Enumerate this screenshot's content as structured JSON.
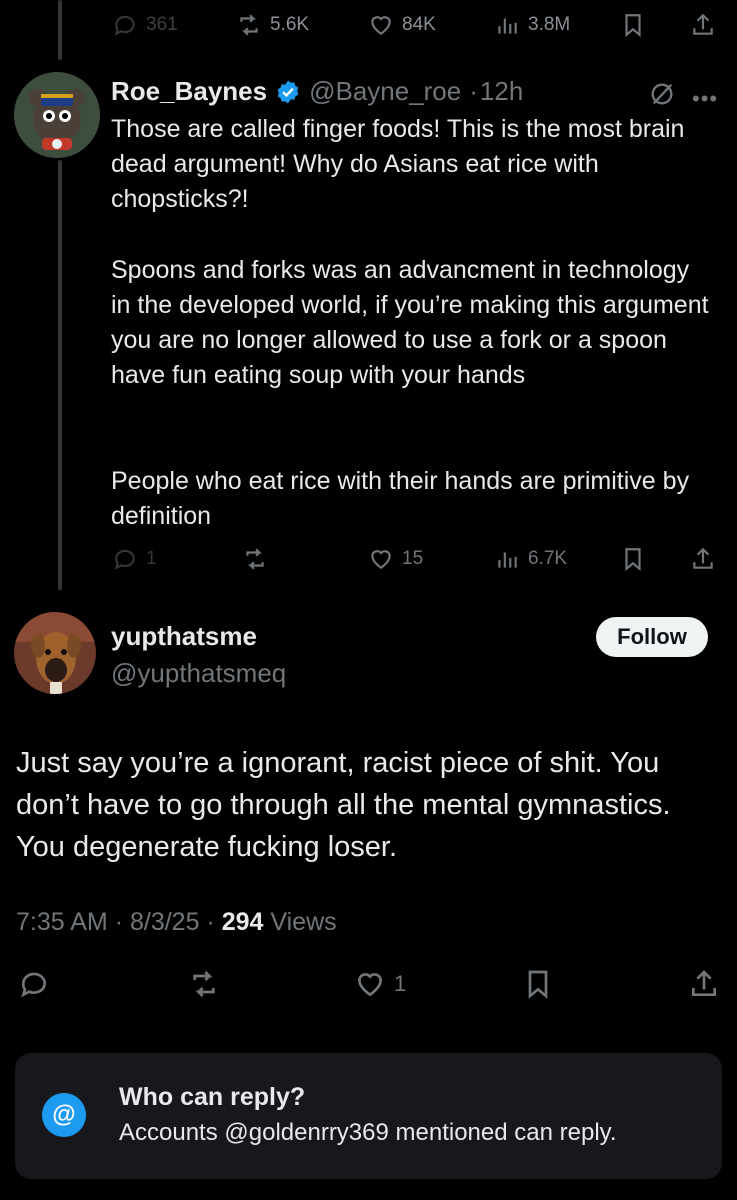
{
  "parent_tweet": {
    "replies": "361",
    "retweets": "5.6K",
    "likes": "84K",
    "views": "3.8M"
  },
  "reply_tweet": {
    "name": "Roe_Baynes",
    "handle": "@Bayne_roe",
    "separator": "·",
    "time": "12h",
    "paragraphs": [
      "Those are called finger foods! This is the most brain dead argument! Why do Asians eat rice with chopsticks?!",
      "Spoons and forks was an advancment in technology in the developed world, if you’re making this argument you are no longer allowed to use a fork or a spoon have fun eating soup with your hands",
      "People who eat rice with their hands are primitive by definition"
    ],
    "replies": "1",
    "likes": "15",
    "views": "6.7K"
  },
  "main_tweet": {
    "name": "yupthatsme",
    "handle": "@yupthatsmeq",
    "follow_label": "Follow",
    "text": "Just say you’re a ignorant, racist piece of shit. You don’t have to go through all the mental gymnastics. You degenerate fucking loser.",
    "time": "7:35 AM",
    "date": "8/3/25",
    "sep": "·",
    "views_count": "294",
    "views_label": "Views",
    "likes": "1"
  },
  "who_can_reply": {
    "icon": "@",
    "title": "Who can reply?",
    "description": "Accounts @goldenrry369 mentioned can reply."
  },
  "colors": {
    "background": "#000000",
    "text": "#e7e9ea",
    "muted": "#71767b",
    "accent": "#1d9bf0",
    "card": "#16181c"
  }
}
